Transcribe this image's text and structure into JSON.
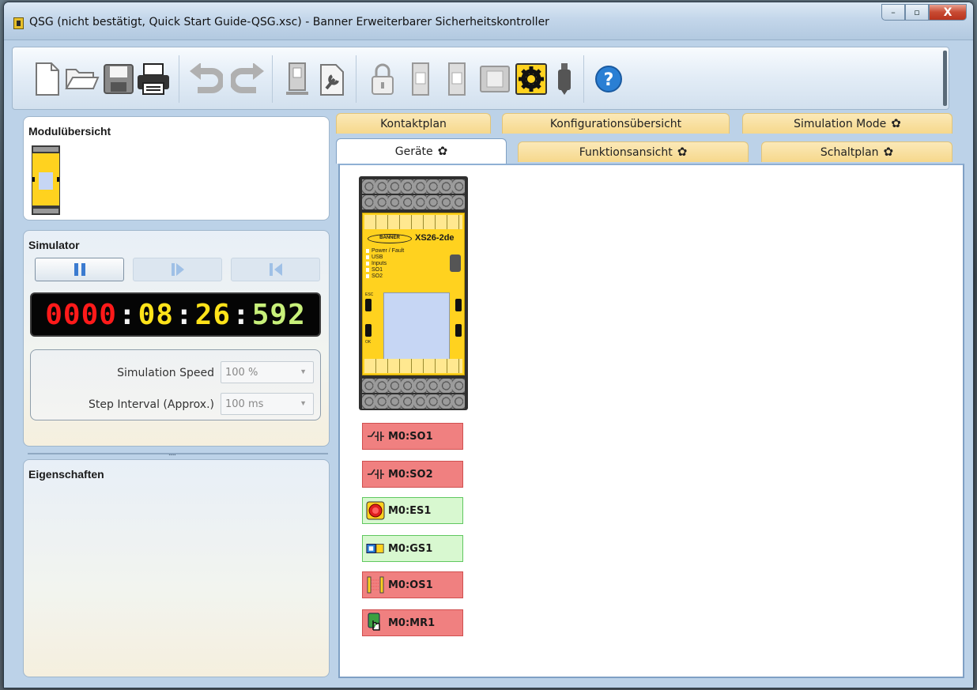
{
  "window": {
    "title": "QSG (nicht bestätigt, Quick Start Guide-QSG.xsc) - Banner Erweiterbarer Sicherheitskontroller",
    "controls": {
      "minimize": "–",
      "maximize": "▫",
      "close": "X"
    }
  },
  "toolbar": {
    "buttons": [
      {
        "name": "new-file",
        "icon": "new-file-icon"
      },
      {
        "name": "open-folder",
        "icon": "open-folder-icon"
      },
      {
        "name": "save",
        "icon": "save-icon"
      },
      {
        "name": "print",
        "icon": "print-icon"
      },
      {
        "name": "undo",
        "icon": "undo-icon"
      },
      {
        "name": "redo",
        "icon": "redo-icon"
      },
      {
        "name": "device-connect",
        "icon": "device-icon"
      },
      {
        "name": "configure",
        "icon": "wrench-doc-icon"
      },
      {
        "name": "lock",
        "icon": "lock-icon"
      },
      {
        "name": "send-config",
        "icon": "send-config-icon"
      },
      {
        "name": "receive-config",
        "icon": "receive-config-icon"
      },
      {
        "name": "module",
        "icon": "module-icon"
      },
      {
        "name": "simulation-mode",
        "icon": "gear-icon"
      },
      {
        "name": "usb",
        "icon": "usb-icon"
      },
      {
        "name": "help",
        "icon": "help-icon"
      }
    ]
  },
  "module_overview": {
    "title": "Modulübersicht"
  },
  "simulator": {
    "title": "Simulator",
    "clock": {
      "part1": "0000",
      "sep": ":",
      "part2": "08",
      "part3": "26",
      "part4": "592"
    },
    "speed_label": "Simulation Speed",
    "speed_value": "100 %",
    "interval_label": "Step Interval (Approx.)",
    "interval_value": "100 ms"
  },
  "properties": {
    "title": "Eigenschaften",
    "splitter_grip": "....."
  },
  "tabs": {
    "row1": [
      "Kontaktplan",
      "Konfigurationsübersicht",
      "Simulation Mode"
    ],
    "row2": [
      "Geräte",
      "Funktionsansicht",
      "Schaltplan"
    ],
    "gear_glyph": "✿"
  },
  "device": {
    "brand": "BANNER",
    "model": "XS26-2de",
    "leds": [
      "Power / Fault",
      "USB",
      "Inputs",
      "SO1",
      "SO2"
    ],
    "side_labels": {
      "esc": "ESC",
      "ok": "OK"
    }
  },
  "io_items": [
    {
      "label": "M0:SO1",
      "state": "red",
      "icon": "safety-output-icon"
    },
    {
      "label": "M0:SO2",
      "state": "red",
      "icon": "safety-output-icon"
    },
    {
      "label": "M0:ES1",
      "state": "green",
      "icon": "emergency-stop-icon"
    },
    {
      "label": "M0:GS1",
      "state": "green",
      "icon": "gate-switch-icon"
    },
    {
      "label": "M0:OS1",
      "state": "red",
      "icon": "optical-sensor-icon"
    },
    {
      "label": "M0:MR1",
      "state": "red",
      "icon": "manual-reset-icon"
    }
  ],
  "colors": {
    "clock_red": "#ff1a1a",
    "clock_yellow": "#ffe31a",
    "clock_green": "#c8f07a",
    "io_red": "#f08080",
    "io_green": "#d8f8d0",
    "tab_inactive": "#f6d88c",
    "device_yellow": "#ffd21f"
  }
}
